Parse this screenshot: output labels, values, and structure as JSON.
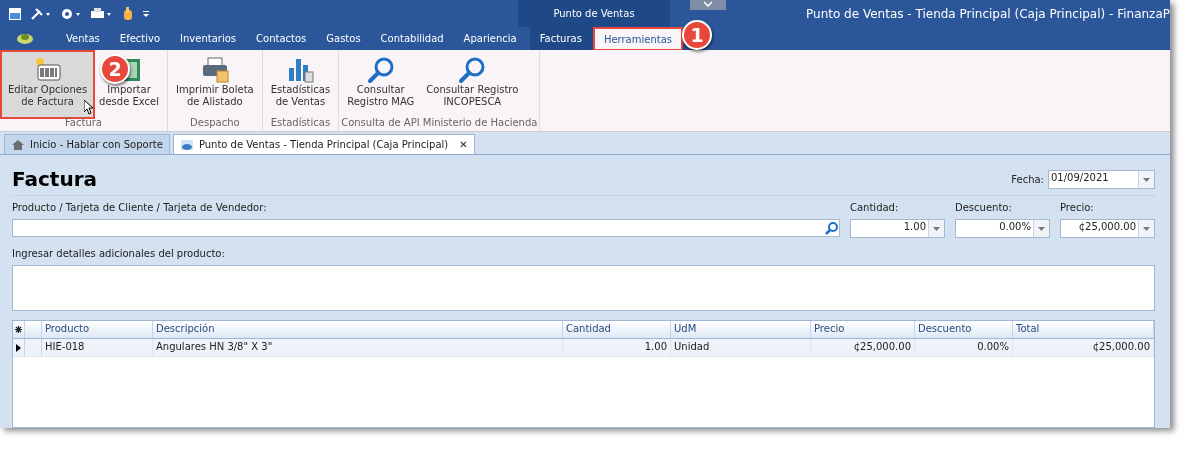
{
  "window": {
    "title": "Punto de Ventas - Tienda Principal (Caja Principal) - FinanzaP"
  },
  "context_group": {
    "label": "Punto de Ventas"
  },
  "ribbon_tabs": [
    {
      "label": "Ventas",
      "selected": false
    },
    {
      "label": "Efectivo",
      "selected": false
    },
    {
      "label": "Inventarios",
      "selected": false
    },
    {
      "label": "Contactos",
      "selected": false
    },
    {
      "label": "Gastos",
      "selected": false
    },
    {
      "label": "Contabilidad",
      "selected": false
    },
    {
      "label": "Apariencia",
      "selected": false
    }
  ],
  "context_tabs": [
    {
      "label": "Facturas",
      "selected": false
    },
    {
      "label": "Herramientas",
      "selected": true
    }
  ],
  "ribbon_groups": [
    {
      "label": "Factura",
      "buttons": [
        {
          "kind": "barcode",
          "lines": [
            "Editar Opciones",
            "de Factura"
          ],
          "selected": true
        },
        {
          "kind": "excel",
          "lines": [
            "Importar",
            "desde Excel"
          ],
          "selected": false
        }
      ]
    },
    {
      "label": "Despacho",
      "buttons": [
        {
          "kind": "printer",
          "lines": [
            "Imprimir Boleta",
            "de Alistado"
          ],
          "selected": false
        }
      ]
    },
    {
      "label": "Estadísticas",
      "buttons": [
        {
          "kind": "chart",
          "lines": [
            "Estadísticas",
            "de Ventas"
          ],
          "selected": false
        }
      ]
    },
    {
      "label": "Consulta de API Ministerio de Hacienda",
      "buttons": [
        {
          "kind": "search",
          "lines": [
            "Consultar",
            "Registro MAG"
          ],
          "selected": false
        },
        {
          "kind": "search",
          "lines": [
            "Consultar Registro",
            "INCOPESCA"
          ],
          "selected": false
        }
      ]
    }
  ],
  "callouts": [
    {
      "number": "1"
    },
    {
      "number": "2"
    }
  ],
  "doc_tabs": [
    {
      "label": "Inicio - Hablar con Soporte",
      "kind": "home",
      "selected": false
    },
    {
      "label": "Punto de Ventas - Tienda Principal (Caja Principal)",
      "kind": "pos",
      "selected": true,
      "close": "✕"
    }
  ],
  "form": {
    "title": "Factura",
    "date_label": "Fecha:",
    "date_value": "01/09/2021",
    "product_label": "Producto / Tarjeta de Cliente / Tarjeta de Vendedor:",
    "quantity_label": "Cantidad:",
    "quantity_value": "1.00",
    "discount_label": "Descuento:",
    "discount_value": "0.00%",
    "price_label": "Precio:",
    "price_value": "¢25,000.00",
    "details_label": "Ingresar detalles adicionales del producto:"
  },
  "table": {
    "columns": [
      "Producto",
      "Descripción",
      "Cantidad",
      "UdM",
      "Precio",
      "Descuento",
      "Total"
    ],
    "rows": [
      {
        "cells": [
          "HIE-018",
          "Angulares HN 3/8\" X 3\"",
          "1.00",
          "Unidad",
          "¢25,000.00",
          "0.00%",
          "¢25,000.00"
        ],
        "selected": true
      }
    ]
  }
}
